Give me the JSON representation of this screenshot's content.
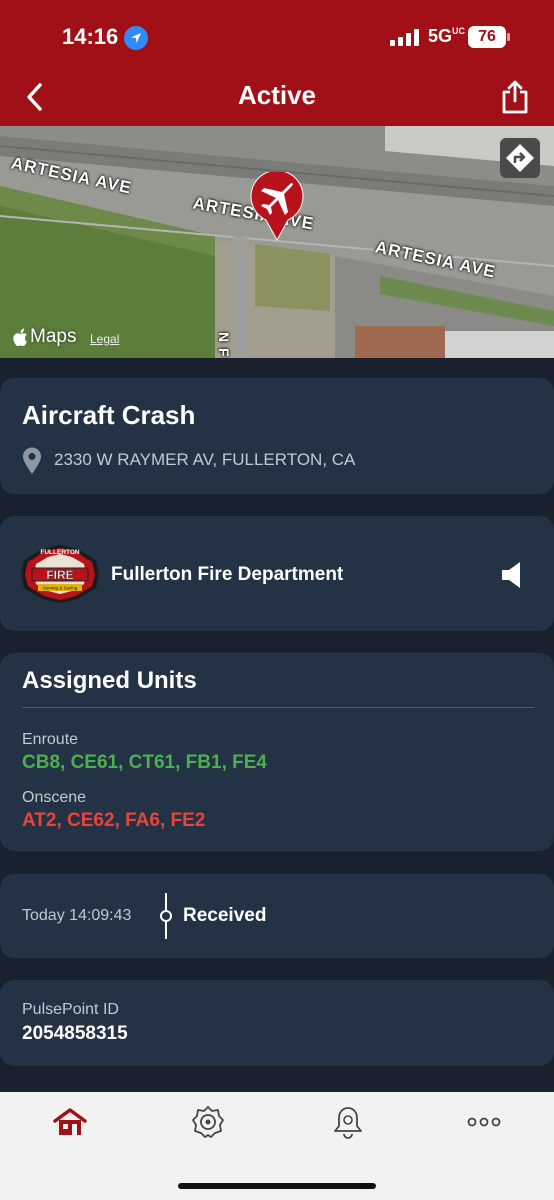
{
  "status_bar": {
    "time": "14:16",
    "network": "5G",
    "network_suffix": "UC",
    "battery": "76"
  },
  "header": {
    "title": "Active",
    "back_icon": "chevron-left-icon",
    "share_icon": "share-icon"
  },
  "map": {
    "streets": [
      "ARTESIA AVE",
      "ARTESIA AVE",
      "ARTESIA AVE",
      "N F"
    ],
    "maps_label": "Maps",
    "legal_label": "Legal",
    "marker_icon": "airplane-icon",
    "directions_icon": "directions-icon"
  },
  "incident": {
    "type": "Aircraft Crash",
    "address": "2330 W RAYMER AV, FULLERTON, CA"
  },
  "agency": {
    "name": "Fullerton Fire Department",
    "logo_top": "FULLERTON",
    "logo_main": "FIRE",
    "logo_bottom": "Serving & Saving"
  },
  "units": {
    "title": "Assigned Units",
    "enroute_label": "Enroute",
    "enroute": "CB8, CE61, CT61, FB1, FE4",
    "onscene_label": "Onscene",
    "onscene": "AT2, CE62, FA6, FE2"
  },
  "timeline": {
    "time": "Today 14:09:43",
    "status": "Received"
  },
  "pulsepoint": {
    "label": "PulsePoint ID",
    "id": "2054858315"
  },
  "tabbar": {
    "items": [
      "home-icon",
      "fire-badge-icon",
      "alert-bell-icon",
      "more-icon"
    ]
  },
  "colors": {
    "header": "#a01016",
    "background": "#18212d",
    "card": "#233245",
    "enroute": "#4caf50",
    "onscene": "#e8443a"
  }
}
